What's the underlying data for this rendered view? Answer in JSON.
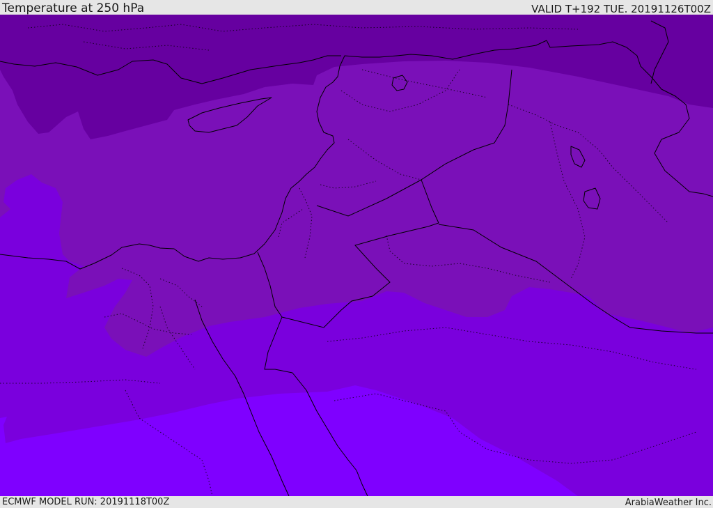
{
  "header": {
    "title": "Temperature at 250 hPa",
    "valid_time": "VALID T+192 TUE. 20191126T00Z"
  },
  "footer": {
    "model_run": "ECMWF MODEL RUN: 20191118T00Z",
    "credit": "ArabiaWeather Inc."
  },
  "map": {
    "variable": "temperature",
    "level": "250 hPa",
    "colors": {
      "band_coldest": "#6600a0",
      "band_cold": "#7a10b8",
      "band_mid": "#7a00dd",
      "band_warm": "#7f00ff",
      "coastline": "#000000"
    }
  }
}
